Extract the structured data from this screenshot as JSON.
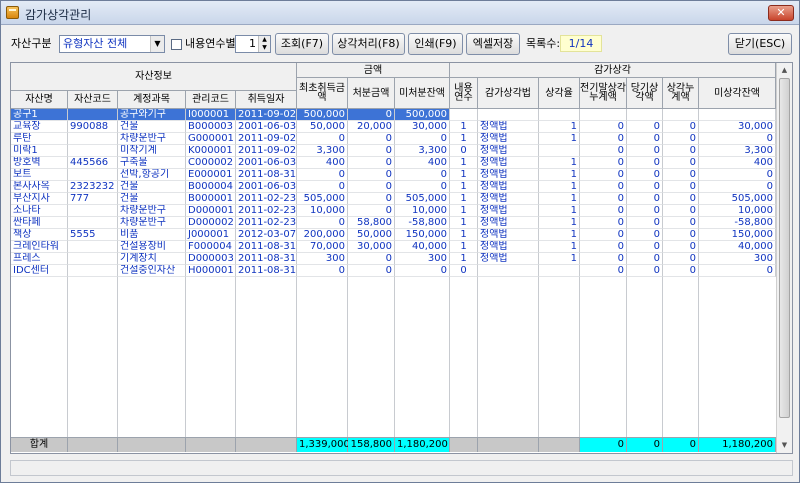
{
  "window": {
    "title": "감가상각관리",
    "close_symbol": "✕"
  },
  "toolbar": {
    "asset_type_label": "자산구분",
    "asset_type_value": "유형자산 전체",
    "years_checkbox_label": "내용연수별",
    "years_value": "1",
    "query_button": "조회(F7)",
    "process_button": "상각처리(F8)",
    "print_button": "인쇄(F9)",
    "excel_button": "엑셀저장",
    "count_label": "목록수:",
    "count_value": "1/14",
    "close_button": "닫기(ESC)"
  },
  "headers": {
    "group_asset": "자산정보",
    "group_amount": "금액",
    "group_depreciation": "감가상각",
    "columns": [
      "자산명",
      "자산코드",
      "계정과목",
      "관리코드",
      "취득일자",
      "최초취득금액",
      "처분금액",
      "미처분잔액",
      "내용연수",
      "감가상각법",
      "상각율",
      "전기말상각누계액",
      "당기상각액",
      "상각누계액",
      "미상각잔액"
    ]
  },
  "rows": [
    [
      "공구1",
      "",
      "공구와기구",
      "I000001",
      "2011-09-02",
      "500,000",
      "0",
      "500,000",
      "1",
      "정액법",
      "1",
      "0",
      "0",
      "0",
      "500,000"
    ],
    [
      "교육장",
      "990088",
      "건물",
      "B000003",
      "2001-06-03",
      "50,000",
      "20,000",
      "30,000",
      "1",
      "정액법",
      "1",
      "0",
      "0",
      "0",
      "30,000"
    ],
    [
      "루탄",
      "",
      "차량운반구",
      "G000001",
      "2011-09-02",
      "0",
      "0",
      "0",
      "1",
      "정액법",
      "1",
      "0",
      "0",
      "0",
      "0"
    ],
    [
      "미락1",
      "",
      "미착기계",
      "K000001",
      "2011-09-02",
      "3,300",
      "0",
      "3,300",
      "0",
      "정액법",
      "",
      "0",
      "0",
      "0",
      "3,300"
    ],
    [
      "방호벽",
      "445566",
      "구축물",
      "C000002",
      "2001-06-03",
      "400",
      "0",
      "400",
      "1",
      "정액법",
      "1",
      "0",
      "0",
      "0",
      "400"
    ],
    [
      "보트",
      "",
      "선박,항공기",
      "E000001",
      "2011-08-31",
      "0",
      "0",
      "0",
      "1",
      "정액법",
      "1",
      "0",
      "0",
      "0",
      "0"
    ],
    [
      "본사사옥",
      "2323232",
      "건물",
      "B000004",
      "2001-06-03",
      "0",
      "0",
      "0",
      "1",
      "정액법",
      "1",
      "0",
      "0",
      "0",
      "0"
    ],
    [
      "부산지사",
      "777",
      "건물",
      "B000001",
      "2011-02-23",
      "505,000",
      "0",
      "505,000",
      "1",
      "정액법",
      "1",
      "0",
      "0",
      "0",
      "505,000"
    ],
    [
      "소나타",
      "",
      "차량운반구",
      "D000001",
      "2011-02-23",
      "10,000",
      "0",
      "10,000",
      "1",
      "정액법",
      "1",
      "0",
      "0",
      "0",
      "10,000"
    ],
    [
      "싼타페",
      "",
      "차량운반구",
      "D000002",
      "2011-02-23",
      "0",
      "58,800",
      "-58,800",
      "1",
      "정액법",
      "1",
      "0",
      "0",
      "0",
      "-58,800"
    ],
    [
      "책상",
      "5555",
      "비품",
      "J000001",
      "2012-03-07",
      "200,000",
      "50,000",
      "150,000",
      "1",
      "정액법",
      "1",
      "0",
      "0",
      "0",
      "150,000"
    ],
    [
      "크레인타워",
      "",
      "건설용장비",
      "F000004",
      "2011-08-31",
      "70,000",
      "30,000",
      "40,000",
      "1",
      "정액법",
      "1",
      "0",
      "0",
      "0",
      "40,000"
    ],
    [
      "프레스",
      "",
      "기계장치",
      "D000003",
      "2011-08-31",
      "300",
      "0",
      "300",
      "1",
      "정액법",
      "1",
      "0",
      "0",
      "0",
      "300"
    ],
    [
      "IDC센터",
      "",
      "건설중인자산",
      "H000001",
      "2011-08-31",
      "0",
      "0",
      "0",
      "0",
      "",
      "",
      "0",
      "0",
      "0",
      "0"
    ]
  ],
  "totals": {
    "label": "합계",
    "initial_amount": "1,339,000",
    "disposal_amount": "158,800",
    "undisposed_balance": "1,180,200",
    "prior_accum": "0",
    "current_dep": "0",
    "accum": "0",
    "undepreciated": "1,180,200"
  }
}
